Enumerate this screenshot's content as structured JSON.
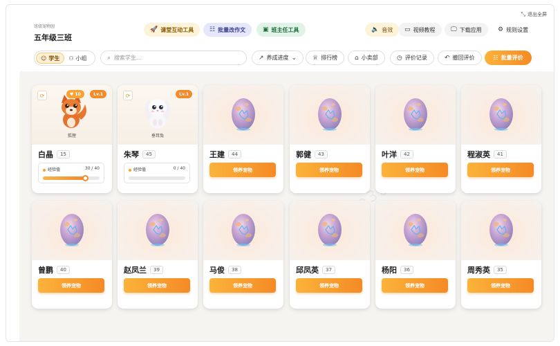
{
  "window": {
    "fullscreen_label": "退出全屏"
  },
  "header": {
    "subtitle": "班级宠物园",
    "class_name": "五年级三班"
  },
  "toolbar": {
    "classroom_tools": "课堂互动工具",
    "batch_essay": "批量改作文",
    "teacher_tools": "班主任工具",
    "sound": "音效",
    "video_tutorial": "视频教程",
    "download_app": "下载应用",
    "rule_settings": "规则设置"
  },
  "filters": {
    "tab_students": "学生",
    "tab_groups": "小组",
    "search_placeholder": "搜索学生...",
    "progress_select": "养成进度",
    "leaderboard": "排行榜",
    "shop": "小卖部",
    "eval_records": "评价记录",
    "undo_eval": "撤回评价",
    "batch_eval": "批量评价"
  },
  "labels": {
    "adopt": "领养宠物",
    "exp": "经验值"
  },
  "students": [
    {
      "name": "白晶",
      "count": "15",
      "pet": "狐狸",
      "hearts": "10",
      "level": "Lv.1",
      "exp": "30 / 40",
      "exp_ratio": 0.75,
      "type": "fox"
    },
    {
      "name": "朱琴",
      "count": "45",
      "pet": "垂耳兔",
      "level": "Lv.1",
      "exp": "0 / 40",
      "exp_ratio": 0,
      "type": "bunny"
    },
    {
      "name": "王建",
      "count": "44"
    },
    {
      "name": "郭健",
      "count": "43"
    },
    {
      "name": "叶洋",
      "count": "42"
    },
    {
      "name": "程淑英",
      "count": "41"
    },
    {
      "name": "曾鹏",
      "count": "40"
    },
    {
      "name": "赵凤兰",
      "count": "39"
    },
    {
      "name": "马俊",
      "count": "38"
    },
    {
      "name": "邱凤英",
      "count": "37"
    },
    {
      "name": "杨阳",
      "count": "36"
    },
    {
      "name": "周秀英",
      "count": "35"
    }
  ],
  "colors": {
    "accent": "#f58a26",
    "accent_light": "#fbb33a"
  }
}
